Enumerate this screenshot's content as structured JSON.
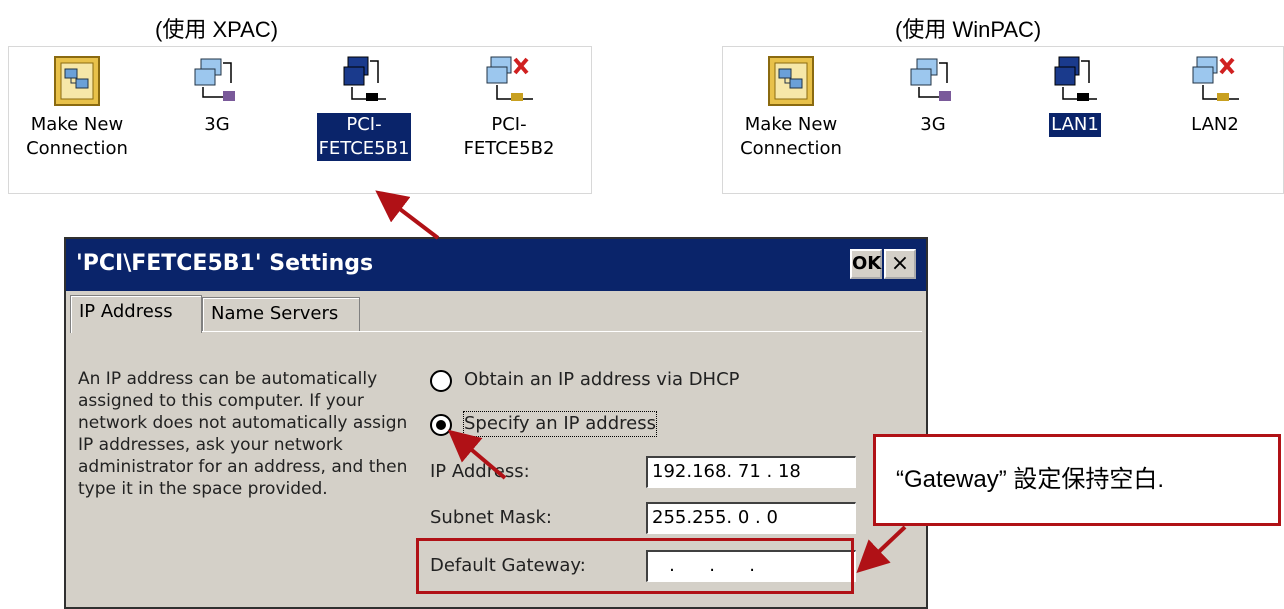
{
  "captions": {
    "left": "(使用 XPAC)",
    "right": "(使用 WinPAC)"
  },
  "xpac_items": [
    {
      "label": "Make New\nConnection",
      "icon": "make-new-connection-icon",
      "selected": false
    },
    {
      "label": "3G",
      "icon": "network-connection-icon",
      "selected": false
    },
    {
      "label": "PCI-\nFETCE5B1",
      "icon": "lan-connection-icon",
      "selected": true
    },
    {
      "label": "PCI-\nFETCE5B2",
      "icon": "lan-disconnected-icon",
      "selected": false
    }
  ],
  "winpac_items": [
    {
      "label": "Make New\nConnection",
      "icon": "make-new-connection-icon",
      "selected": false
    },
    {
      "label": "3G",
      "icon": "network-connection-icon",
      "selected": false
    },
    {
      "label": "LAN1",
      "icon": "lan-connection-icon",
      "selected": true
    },
    {
      "label": "LAN2",
      "icon": "lan-disconnected-icon",
      "selected": false
    }
  ],
  "dialog": {
    "title": "'PCI\\FETCE5B1' Settings",
    "ok_label": "OK",
    "close_label": "×",
    "tabs": [
      "IP Address",
      "Name Servers"
    ],
    "description": "An IP address can be automatically assigned to this computer.  If your network does not automatically assign IP addresses, ask your network administrator for an address, and then type it in the space provided.",
    "radio_dhcp": "Obtain an IP address via DHCP",
    "radio_specify": "Specify an IP address",
    "ip_label": "IP Address:",
    "ip_value": "192.168. 71 . 18",
    "mask_label": "Subnet Mask:",
    "mask_value": "255.255.  0  .  0",
    "gateway_label": "Default Gateway:",
    "gateway_value": "   .      .      ."
  },
  "callout": "“Gateway” 設定保持空白.",
  "colors": {
    "titlebar": "#0a246a",
    "dialog_bg": "#d4d0c8",
    "annotation": "#b01116"
  }
}
